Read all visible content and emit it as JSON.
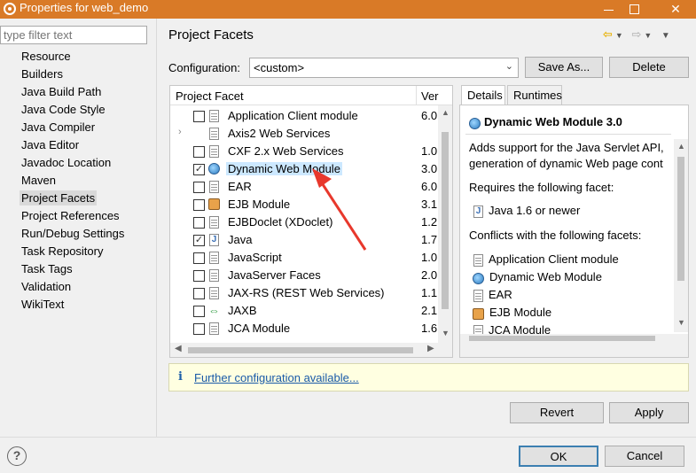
{
  "window": {
    "title": "Properties for web_demo",
    "icon": "gear-icon"
  },
  "filter": {
    "placeholder": "type filter text"
  },
  "nav": {
    "items": [
      "Resource",
      "Builders",
      "Java Build Path",
      "Java Code Style",
      "Java Compiler",
      "Java Editor",
      "Javadoc Location",
      "Maven",
      "Project Facets",
      "Project References",
      "Run/Debug Settings",
      "Task Repository",
      "Task Tags",
      "Validation",
      "WikiText"
    ],
    "selected": "Project Facets"
  },
  "page": {
    "title": "Project Facets"
  },
  "configuration": {
    "label": "Configuration:",
    "value": "<custom>",
    "save_as_label": "Save As...",
    "delete_label": "Delete"
  },
  "facets": {
    "col_facet": "Project Facet",
    "col_version": "Ver",
    "rows": [
      {
        "name": "Application Client module",
        "version": "6.0",
        "checked": false,
        "icon": "document-icon"
      },
      {
        "name": "Axis2 Web Services",
        "version": "",
        "checked": null,
        "icon": "document-icon",
        "expander": true
      },
      {
        "name": "CXF 2.x Web Services",
        "version": "1.0",
        "checked": false,
        "icon": "document-icon"
      },
      {
        "name": "Dynamic Web Module",
        "version": "3.0",
        "checked": true,
        "icon": "globe-icon",
        "selected": true
      },
      {
        "name": "EAR",
        "version": "6.0",
        "checked": false,
        "icon": "document-icon"
      },
      {
        "name": "EJB Module",
        "version": "3.1",
        "checked": false,
        "icon": "jar-icon"
      },
      {
        "name": "EJBDoclet (XDoclet)",
        "version": "1.2.",
        "checked": false,
        "icon": "document-icon"
      },
      {
        "name": "Java",
        "version": "1.7",
        "checked": true,
        "icon": "java-icon"
      },
      {
        "name": "JavaScript",
        "version": "1.0",
        "checked": false,
        "icon": "document-icon"
      },
      {
        "name": "JavaServer Faces",
        "version": "2.0",
        "checked": false,
        "icon": "document-icon"
      },
      {
        "name": "JAX-RS (REST Web Services)",
        "version": "1.1",
        "checked": false,
        "icon": "document-icon"
      },
      {
        "name": "JAXB",
        "version": "2.1",
        "checked": false,
        "icon": "jaxb-icon"
      },
      {
        "name": "JCA Module",
        "version": "1.6",
        "checked": false,
        "icon": "document-icon"
      }
    ]
  },
  "details": {
    "tab_details": "Details",
    "tab_runtimes": "Runtimes",
    "title": "Dynamic Web Module 3.0",
    "desc1": "Adds support for the Java Servlet API,",
    "desc2": "generation of dynamic Web page cont",
    "requires_label": "Requires the following facet:",
    "requires": [
      {
        "name": "Java 1.6 or newer",
        "icon": "java-icon"
      }
    ],
    "conflicts_label": "Conflicts with the following facets:",
    "conflicts": [
      {
        "name": "Application Client module",
        "icon": "document-icon"
      },
      {
        "name": "Dynamic Web Module",
        "icon": "globe-icon"
      },
      {
        "name": "EAR",
        "icon": "document-icon"
      },
      {
        "name": "EJB Module",
        "icon": "jar-icon"
      },
      {
        "name": "JCA Module",
        "icon": "document-icon"
      }
    ]
  },
  "info": {
    "icon_text": "i",
    "link": "Further configuration available..."
  },
  "buttons": {
    "revert": "Revert",
    "apply": "Apply",
    "ok": "OK",
    "cancel": "Cancel",
    "help": "?"
  },
  "colors": {
    "titlebar": "#d97a27",
    "selection": "#cce8ff",
    "link": "#1a5aa8",
    "info_bg": "#ffffe1",
    "arrow": "#e8382c"
  }
}
